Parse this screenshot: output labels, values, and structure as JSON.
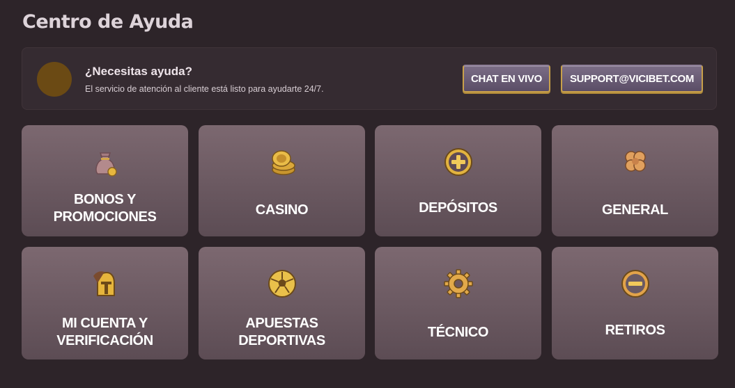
{
  "page": {
    "title": "Centro de Ayuda"
  },
  "help": {
    "heading": "¿Necesitas ayuda?",
    "subtitle": "El servicio de atención al cliente está listo para ayudarte 24/7.",
    "chat_label": "CHAT EN VIVO",
    "email_label": "SUPPORT@VICIBET.COM"
  },
  "categories": [
    {
      "label": "BONOS Y PROMOCIONES",
      "icon": "money-bag-icon"
    },
    {
      "label": "CASINO",
      "icon": "casino-chips-icon"
    },
    {
      "label": "DEPÓSITOS",
      "icon": "plus-coin-icon"
    },
    {
      "label": "GENERAL",
      "icon": "clover-icon"
    },
    {
      "label": "MI CUENTA Y VERIFICACIÓN",
      "icon": "helmet-icon"
    },
    {
      "label": "APUESTAS DEPORTIVAS",
      "icon": "soccer-ball-icon"
    },
    {
      "label": "TÉCNICO",
      "icon": "gear-icon"
    },
    {
      "label": "RETIROS",
      "icon": "minus-coin-icon"
    }
  ],
  "colors": {
    "gold": "#c9a14a",
    "card": "#6e5c64",
    "background": "#2d2429"
  }
}
